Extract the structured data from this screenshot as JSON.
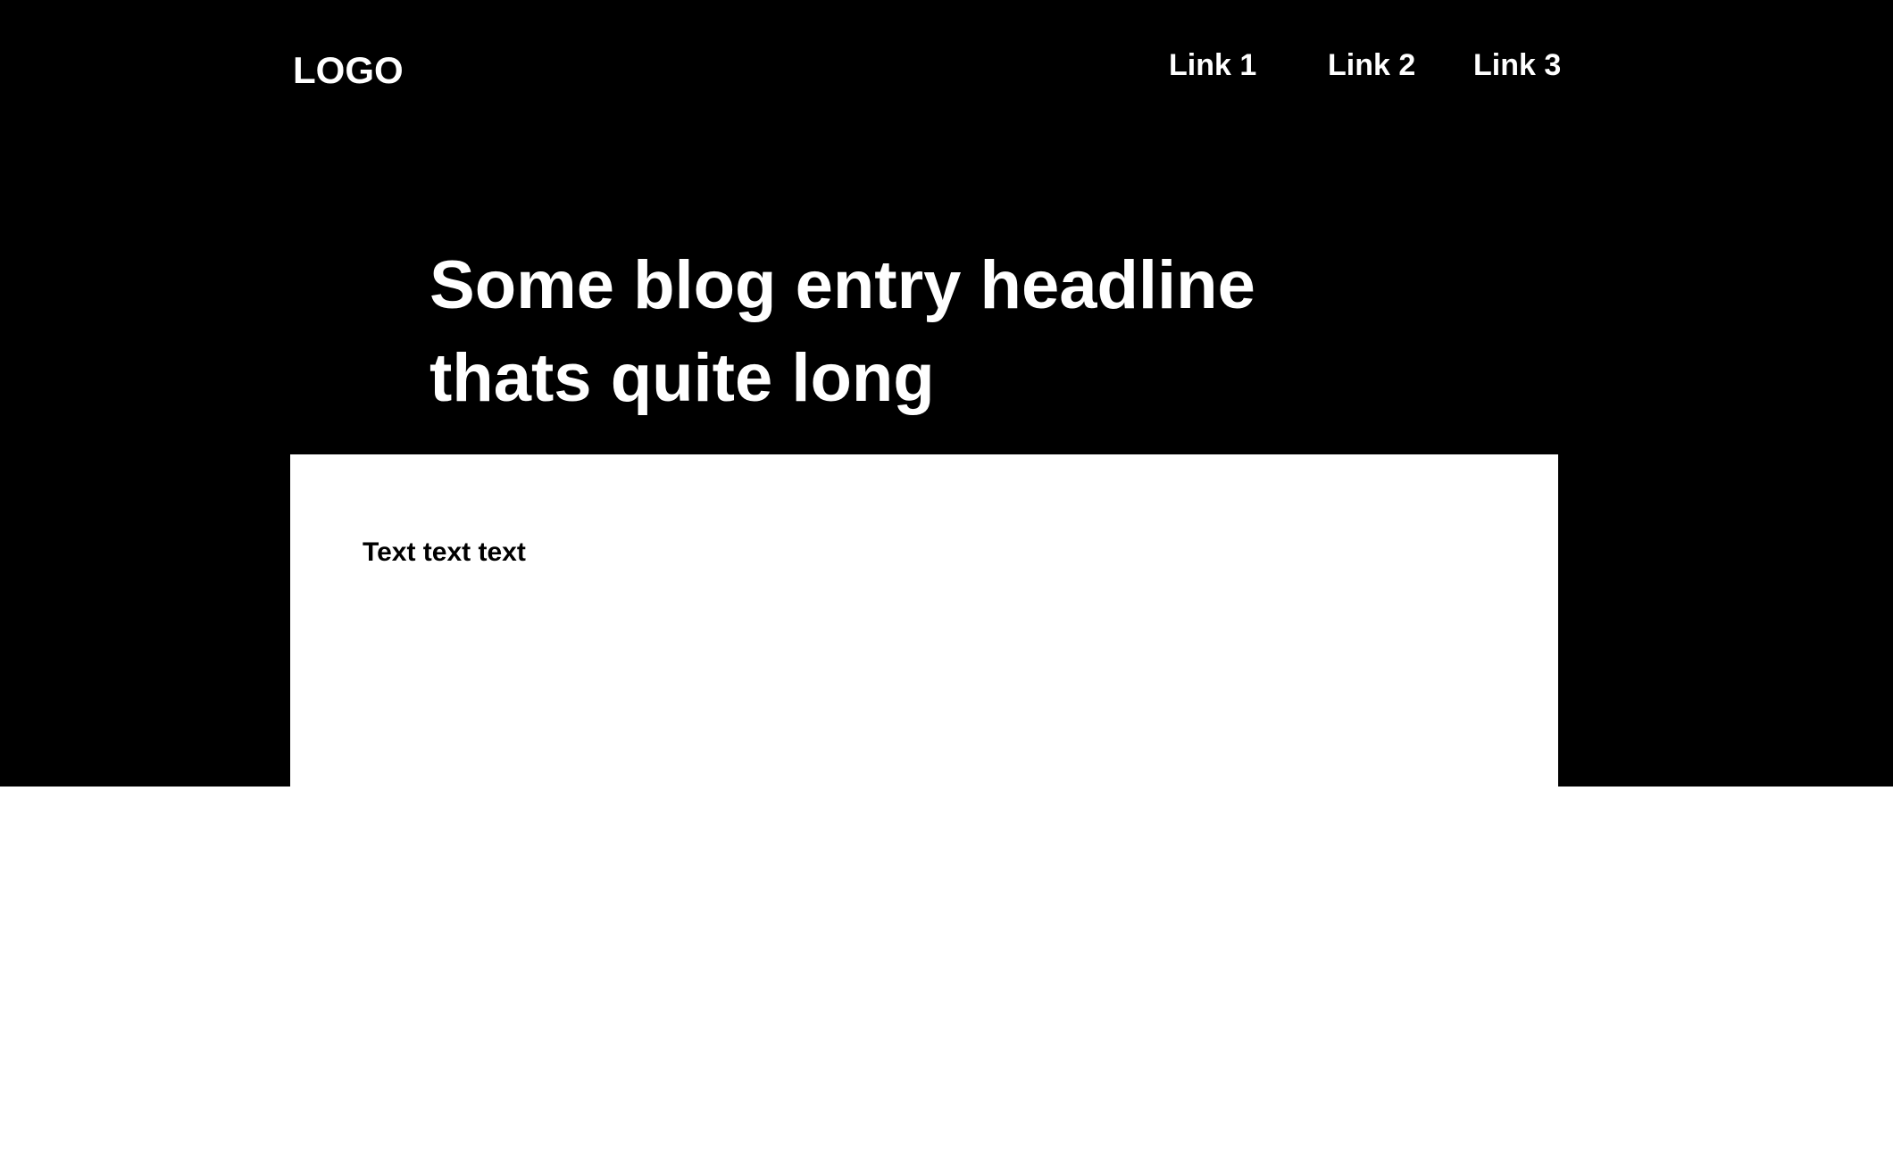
{
  "header": {
    "logo": "LOGO",
    "nav": [
      {
        "label": "Link 1"
      },
      {
        "label": "Link 2"
      },
      {
        "label": "Link 3"
      }
    ]
  },
  "hero": {
    "headline_line1": "Some blog entry headline",
    "headline_line2": "thats quite long"
  },
  "content": {
    "body_text": "Text text text"
  },
  "colors": {
    "hero_background": "#000000",
    "hero_text": "#ffffff",
    "content_background": "#ffffff",
    "content_text": "#000000"
  }
}
